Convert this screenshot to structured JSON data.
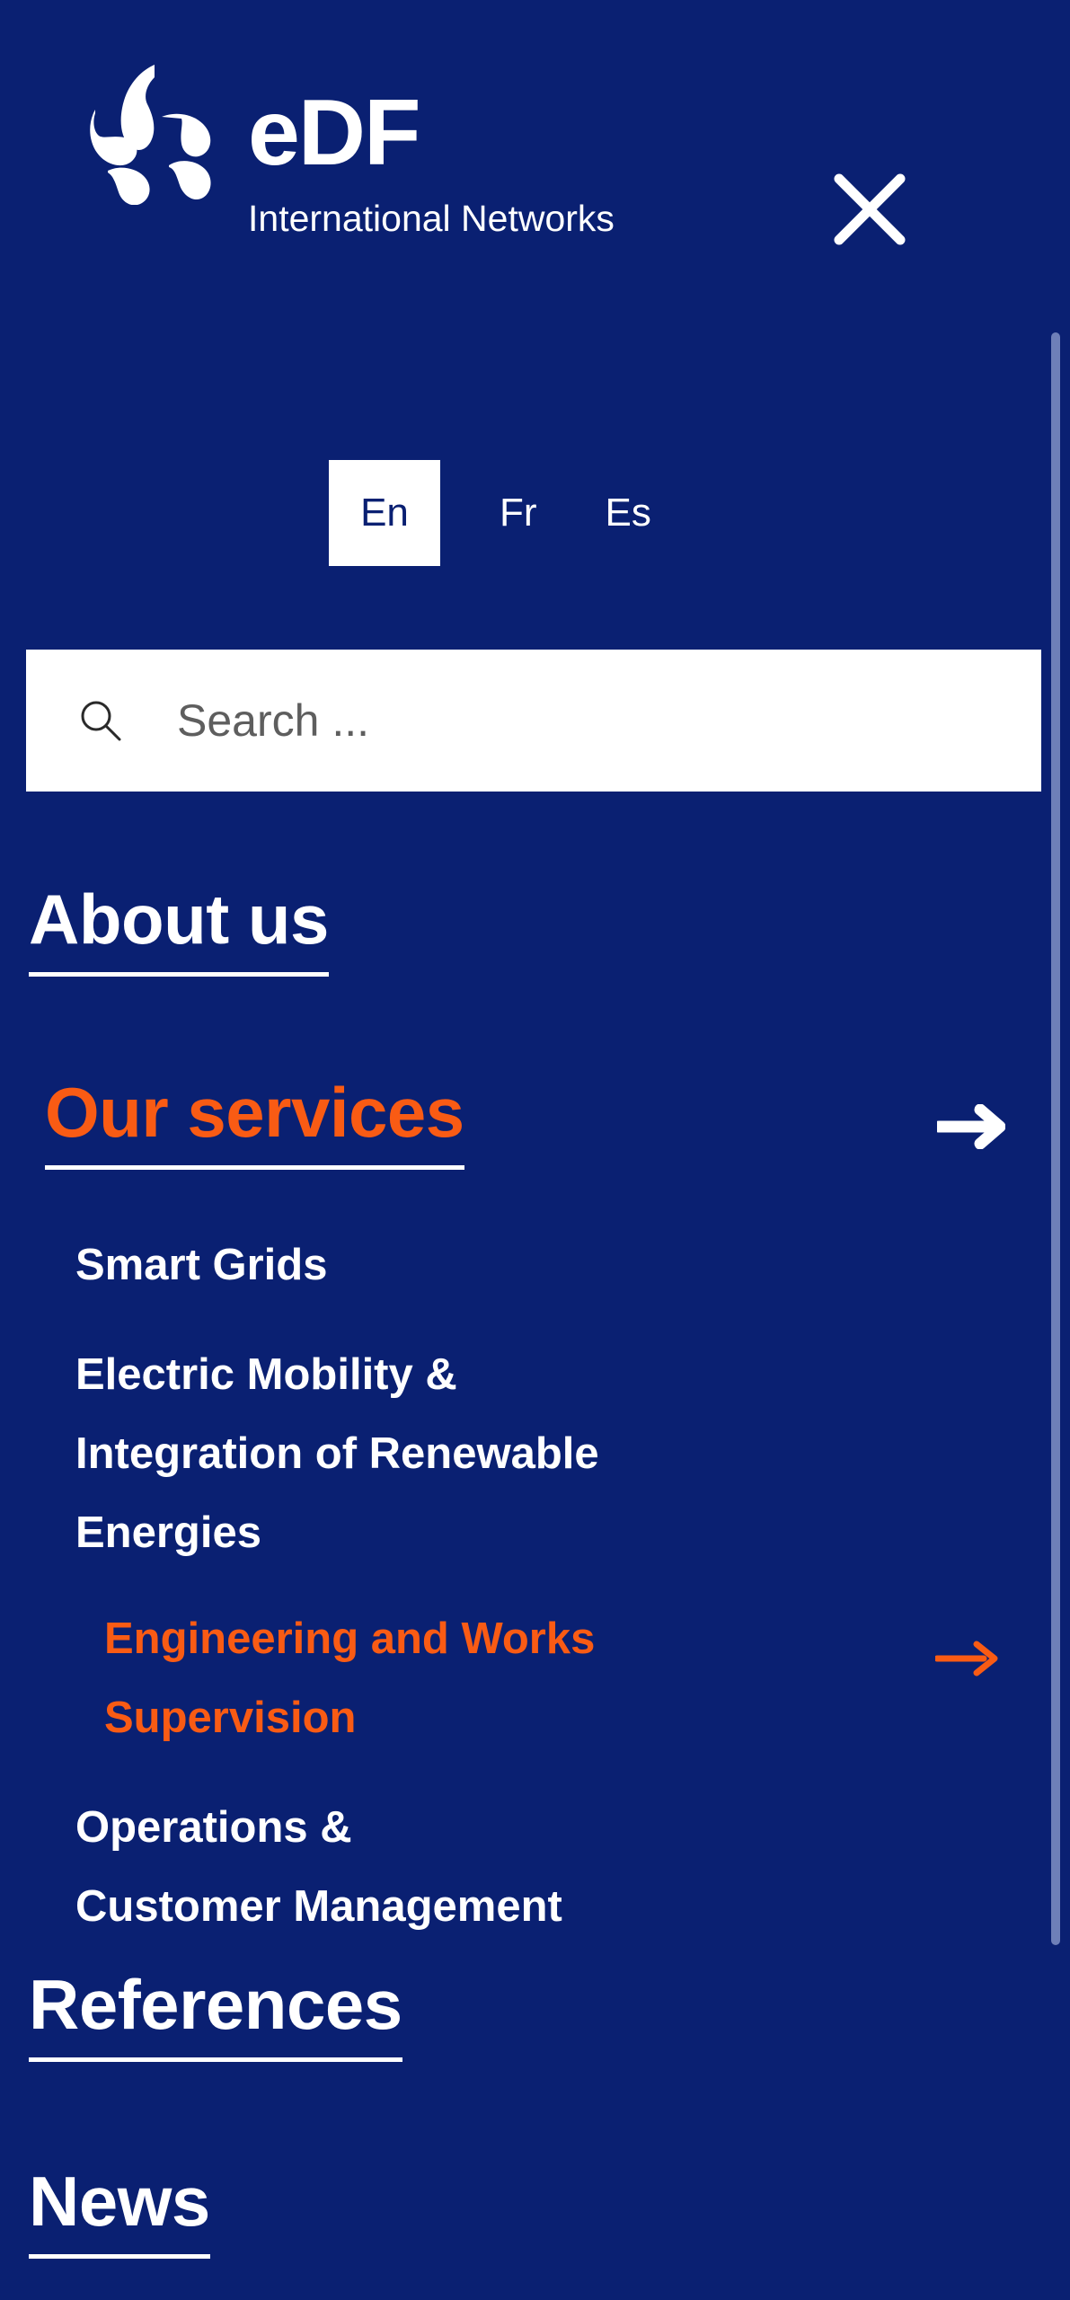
{
  "theme": {
    "background": "#0A2072",
    "accent": "#F95B14",
    "text": "#FFFFFF",
    "search_background": "#FFFFFF",
    "placeholder_color": "#5E5E5E",
    "scrollbar_thumb": "#6E7FB8"
  },
  "header": {
    "brand_name": "eDF",
    "brand_subtitle": "International Networks",
    "logo_icon": "edf-swirl-logo",
    "close_icon": "close-x-icon",
    "close_label": "Close menu"
  },
  "language_switcher": {
    "options": [
      {
        "code": "en",
        "label": "En",
        "active": true
      },
      {
        "code": "fr",
        "label": "Fr",
        "active": false
      },
      {
        "code": "es",
        "label": "Es",
        "active": false
      }
    ]
  },
  "search": {
    "icon": "search-magnifier-icon",
    "placeholder": "Search ...",
    "value": ""
  },
  "navigation": {
    "items": [
      {
        "label": "About us",
        "active": false,
        "has_arrow": false,
        "arrow_icon": "arrow-right-icon"
      },
      {
        "label": "Our services",
        "active": true,
        "has_arrow": true,
        "arrow_icon": "arrow-right-icon",
        "children": [
          {
            "label": "Smart Grids",
            "active": false,
            "has_arrow": false
          },
          {
            "label": "Electric Mobility & Integration of Renewable Energies",
            "active": false,
            "has_arrow": false
          },
          {
            "label": "Engineering and Works Supervision",
            "active": true,
            "has_arrow": true,
            "arrow_icon": "arrow-right-icon"
          },
          {
            "label": "Operations & Customer Management",
            "active": false,
            "has_arrow": false
          }
        ]
      },
      {
        "label": "References",
        "active": false,
        "has_arrow": false
      },
      {
        "label": "News",
        "active": false,
        "has_arrow": false
      }
    ]
  },
  "scrollbar": {
    "name": "page-scrollbar"
  }
}
